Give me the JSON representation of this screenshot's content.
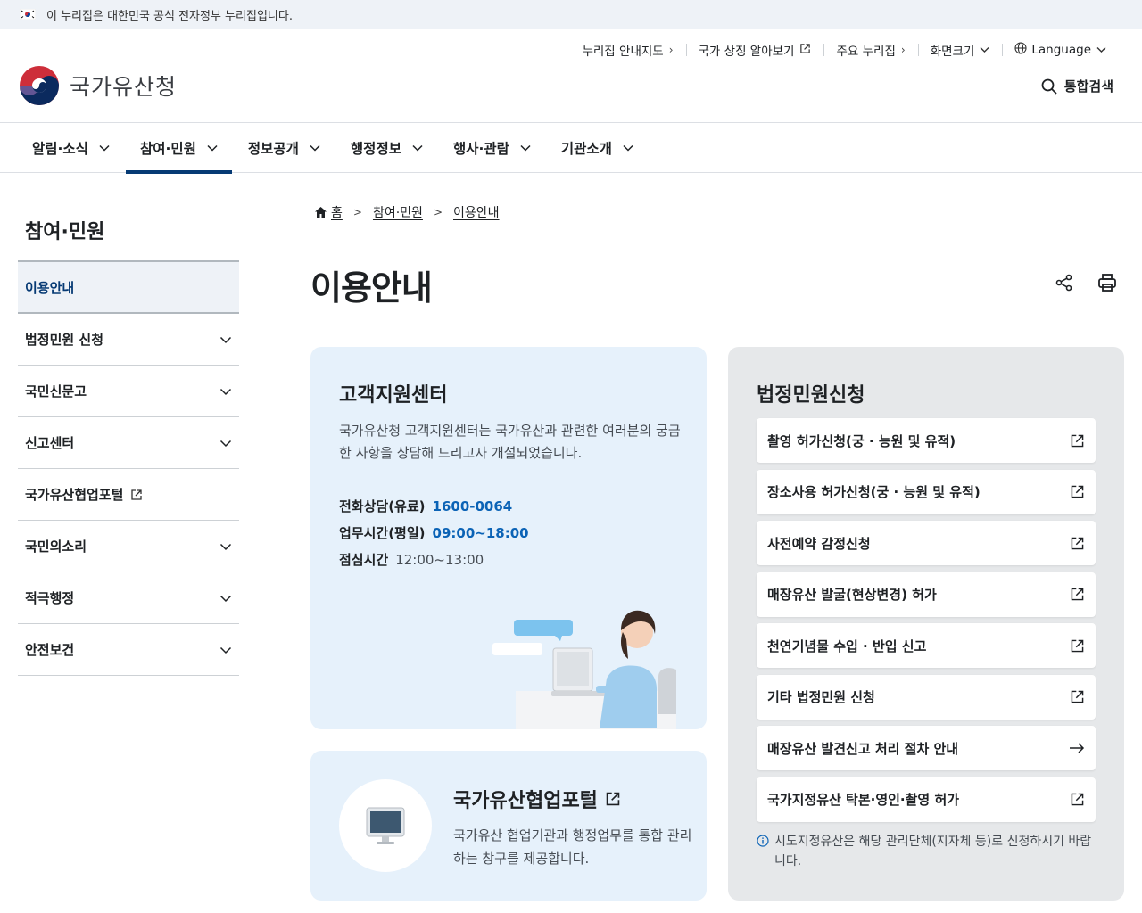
{
  "banner": {
    "text": "이 누리집은 대한민국 공식 전자정부 누리집입니다."
  },
  "logo": {
    "text": "국가유산청"
  },
  "util": [
    {
      "label": "누리집 안내지도",
      "icon": "chevron-right-icon"
    },
    {
      "label": "국가 상징 알아보기",
      "icon": "external-link-icon"
    },
    {
      "label": "주요 누리집",
      "icon": "chevron-right-icon"
    },
    {
      "label": "화면크기",
      "icon": "chevron-down-icon"
    },
    {
      "label": "Language",
      "icon": "chevron-down-icon"
    }
  ],
  "search": {
    "label": "통합검색"
  },
  "gnb": [
    "알림·소식",
    "참여·민원",
    "정보공개",
    "행정정보",
    "행사·관람",
    "기관소개"
  ],
  "gnb_active": "참여·민원",
  "side": {
    "title": "참여·민원",
    "items": [
      "이용안내",
      "법정민원 신청",
      "국민신문고",
      "신고센터",
      "국가유산협업포털",
      "국민의소리",
      "적극행정",
      "안전보건"
    ]
  },
  "breadcrumb": [
    "홈",
    "참여·민원",
    "이용안내"
  ],
  "page_title": "이용안내",
  "support": {
    "title": "고객지원센터",
    "desc": "국가유산청 고객지원센터는 국가유산과 관련한 여러분의 궁금한 사항을 상담해 드리고자 개설되었습니다.",
    "phone_label": "전화상담(유료)",
    "phone": "1600-0064",
    "hours_label": "업무시간(평일)",
    "hours": "09:00~18:00",
    "lunch_label": "점심시간",
    "lunch": "12:00~13:00"
  },
  "portal": {
    "title": "국가유산협업포털",
    "desc": "국가유산 협업기관과 행정업무를 통합 관리하는 창구를 제공합니다."
  },
  "civil": {
    "title": "법정민원신청",
    "items": [
      "촬영 허가신청(궁 · 능원 및 유적)",
      "장소사용 허가신청(궁 · 능원 및 유적)",
      "사전예약 감정신청",
      "매장유산 발굴(현상변경) 허가",
      "천연기념물 수입 · 반입 신고",
      "기타 법정민원 신청",
      "매장유산 발견신고 처리 절차 안내",
      "국가지정유산 탁본·영인·촬영 허가"
    ],
    "note": "시도지정유산은 해당 관리단체(지자체 등)로 신청하시기 바랍니다."
  },
  "colors": {
    "primary": "#063a74",
    "link_blue": "#0b63b6",
    "card_blue": "#e6f1fb",
    "card_gray": "#e6e8ea"
  }
}
